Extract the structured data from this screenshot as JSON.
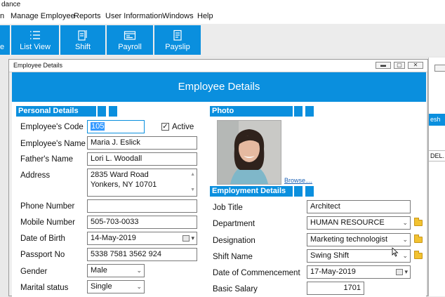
{
  "window_title": "dance",
  "menu": [
    "n",
    "Manage Employee",
    "Reports",
    "User Information",
    "Windows",
    "Help"
  ],
  "toolbar": {
    "partial_label": "e",
    "list_view": "List View",
    "shift": "Shift",
    "payroll": "Payroll",
    "payslip": "Payslip"
  },
  "bg_window": {
    "refresh_label": "esh",
    "del_label": "DEL."
  },
  "child_window": {
    "title": "Employee Details",
    "header": "Employee Details"
  },
  "personal": {
    "heading": "Personal Details",
    "code_label": "Employee's Code",
    "code_value": "105",
    "active_label": "Active",
    "name_label": "Employee's Name",
    "name_value": "Maria J. Eslick",
    "father_label": "Father's Name",
    "father_value": "Lori L. Woodall",
    "address_label": "Address",
    "address_line1": "2835 Ward Road",
    "address_line2": "Yonkers, NY 10701",
    "phone_label": "Phone Number",
    "phone_value": "",
    "mobile_label": "Mobile Number",
    "mobile_value": "505-703-0033",
    "dob_label": "Date of Birth",
    "dob_value": "14-May-2019",
    "passport_label": "Passport No",
    "passport_value": "5338 7581 3562 924",
    "gender_label": "Gender",
    "gender_value": "Male",
    "marital_label": "Marital status",
    "marital_value": "Single"
  },
  "photo": {
    "heading": "Photo",
    "browse_label": "Browse...."
  },
  "employment": {
    "heading": "Employment Details",
    "job_label": "Job Title",
    "job_value": "Architect",
    "dept_label": "Department",
    "dept_value": "HUMAN RESOURCE",
    "desig_label": "Designation",
    "desig_value": "Marketing technologist",
    "shift_label": "Shift Name",
    "shift_value": "Swing Shift",
    "doc_label": "Date of Commencement",
    "doc_value": "17-May-2019",
    "salary_label": "Basic Salary",
    "salary_value": "1701"
  },
  "colors": {
    "accent": "#0a8fde",
    "folder": "#f2c230"
  }
}
